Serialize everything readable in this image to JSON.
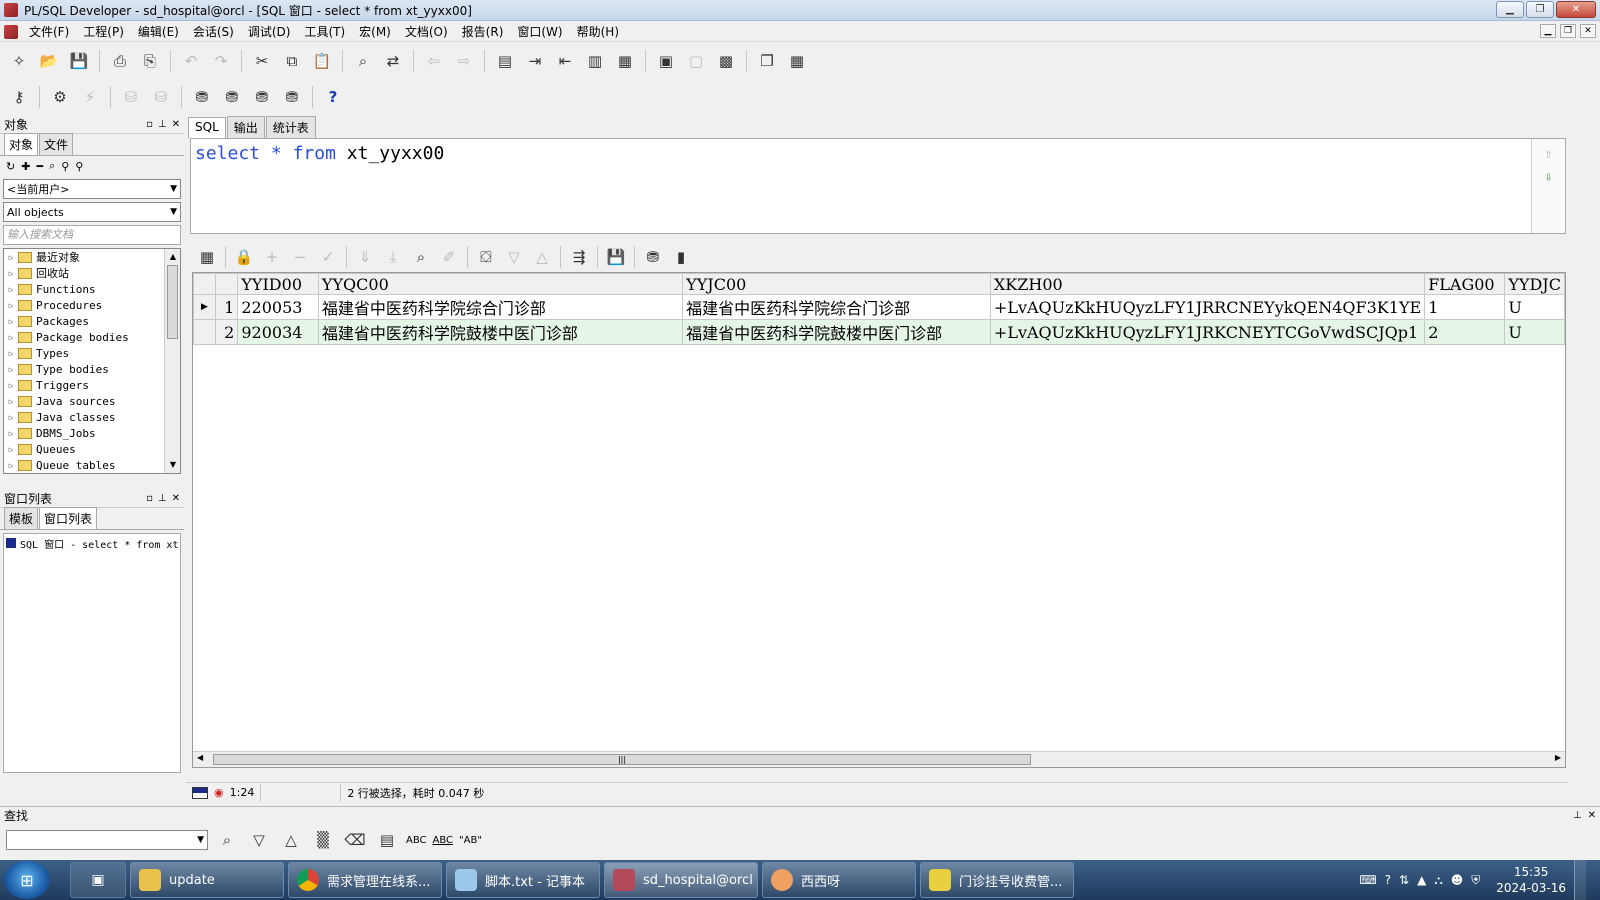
{
  "window": {
    "title": "PL/SQL Developer - sd_hospital@orcl - [SQL 窗口 - select * from xt_yyxx00]"
  },
  "menu": [
    "文件(F)",
    "工程(P)",
    "编辑(E)",
    "会话(S)",
    "调试(D)",
    "工具(T)",
    "宏(M)",
    "文档(O)",
    "报告(R)",
    "窗口(W)",
    "帮助(H)"
  ],
  "object_panel": {
    "title": "对象",
    "tabs": [
      "对象",
      "文件"
    ],
    "user_combo": "<当前用户>",
    "filter_combo": "All objects",
    "search_placeholder": "输入搜索文档",
    "tree": [
      "最近对象",
      "回收站",
      "Functions",
      "Procedures",
      "Packages",
      "Package bodies",
      "Types",
      "Type bodies",
      "Triggers",
      "Java sources",
      "Java classes",
      "DBMS_Jobs",
      "Queues",
      "Queue tables"
    ]
  },
  "window_list_panel": {
    "title": "窗口列表",
    "tabs": [
      "模板",
      "窗口列表"
    ],
    "item": "SQL 窗口 - select * from xt"
  },
  "main_tabs": [
    "SQL",
    "输出",
    "统计表"
  ],
  "editor": {
    "kw_select": "select",
    "star": "*",
    "kw_from": "from",
    "table": "xt_yyxx00"
  },
  "grid": {
    "columns": [
      "YYID00",
      "YYQC00",
      "YYJC00",
      "XKZH00",
      "FLAG00",
      "YYDJC"
    ],
    "rows": [
      {
        "n": "1",
        "cells": [
          "220053",
          "福建省中医药科学院综合门诊部",
          "福建省中医药科学院综合门诊部",
          "+LvAQUzKkHUQyzLFY1JRRCNEYykQEN4QF3K1YE",
          "1",
          "U"
        ]
      },
      {
        "n": "2",
        "cells": [
          "920034",
          "福建省中医药科学院鼓楼中医门诊部",
          "福建省中医药科学院鼓楼中医门诊部",
          "+LvAQUzKkHUQyzLFY1JRKCNEYTCGoVwdSCJQp1",
          "2",
          "U"
        ]
      }
    ],
    "ellipsis": "…"
  },
  "status": {
    "position": "1:24",
    "message": "2 行被选择，耗时 0.047 秒"
  },
  "find": {
    "title": "查找",
    "abc1": "ABC",
    "abc2": "ABC",
    "abc3": "\"AB\""
  },
  "taskbar": {
    "tasks": [
      "update",
      "需求管理在线系...",
      "脚本.txt - 记事本",
      "sd_hospital@orcl",
      "西西呀",
      "门诊挂号收费管..."
    ],
    "time": "15:35",
    "date": "2024-03-16"
  },
  "colors": {
    "keyword": "#2a4ed8",
    "alt_row": "#e6f6e6",
    "taskbar": "#2a4a70"
  }
}
